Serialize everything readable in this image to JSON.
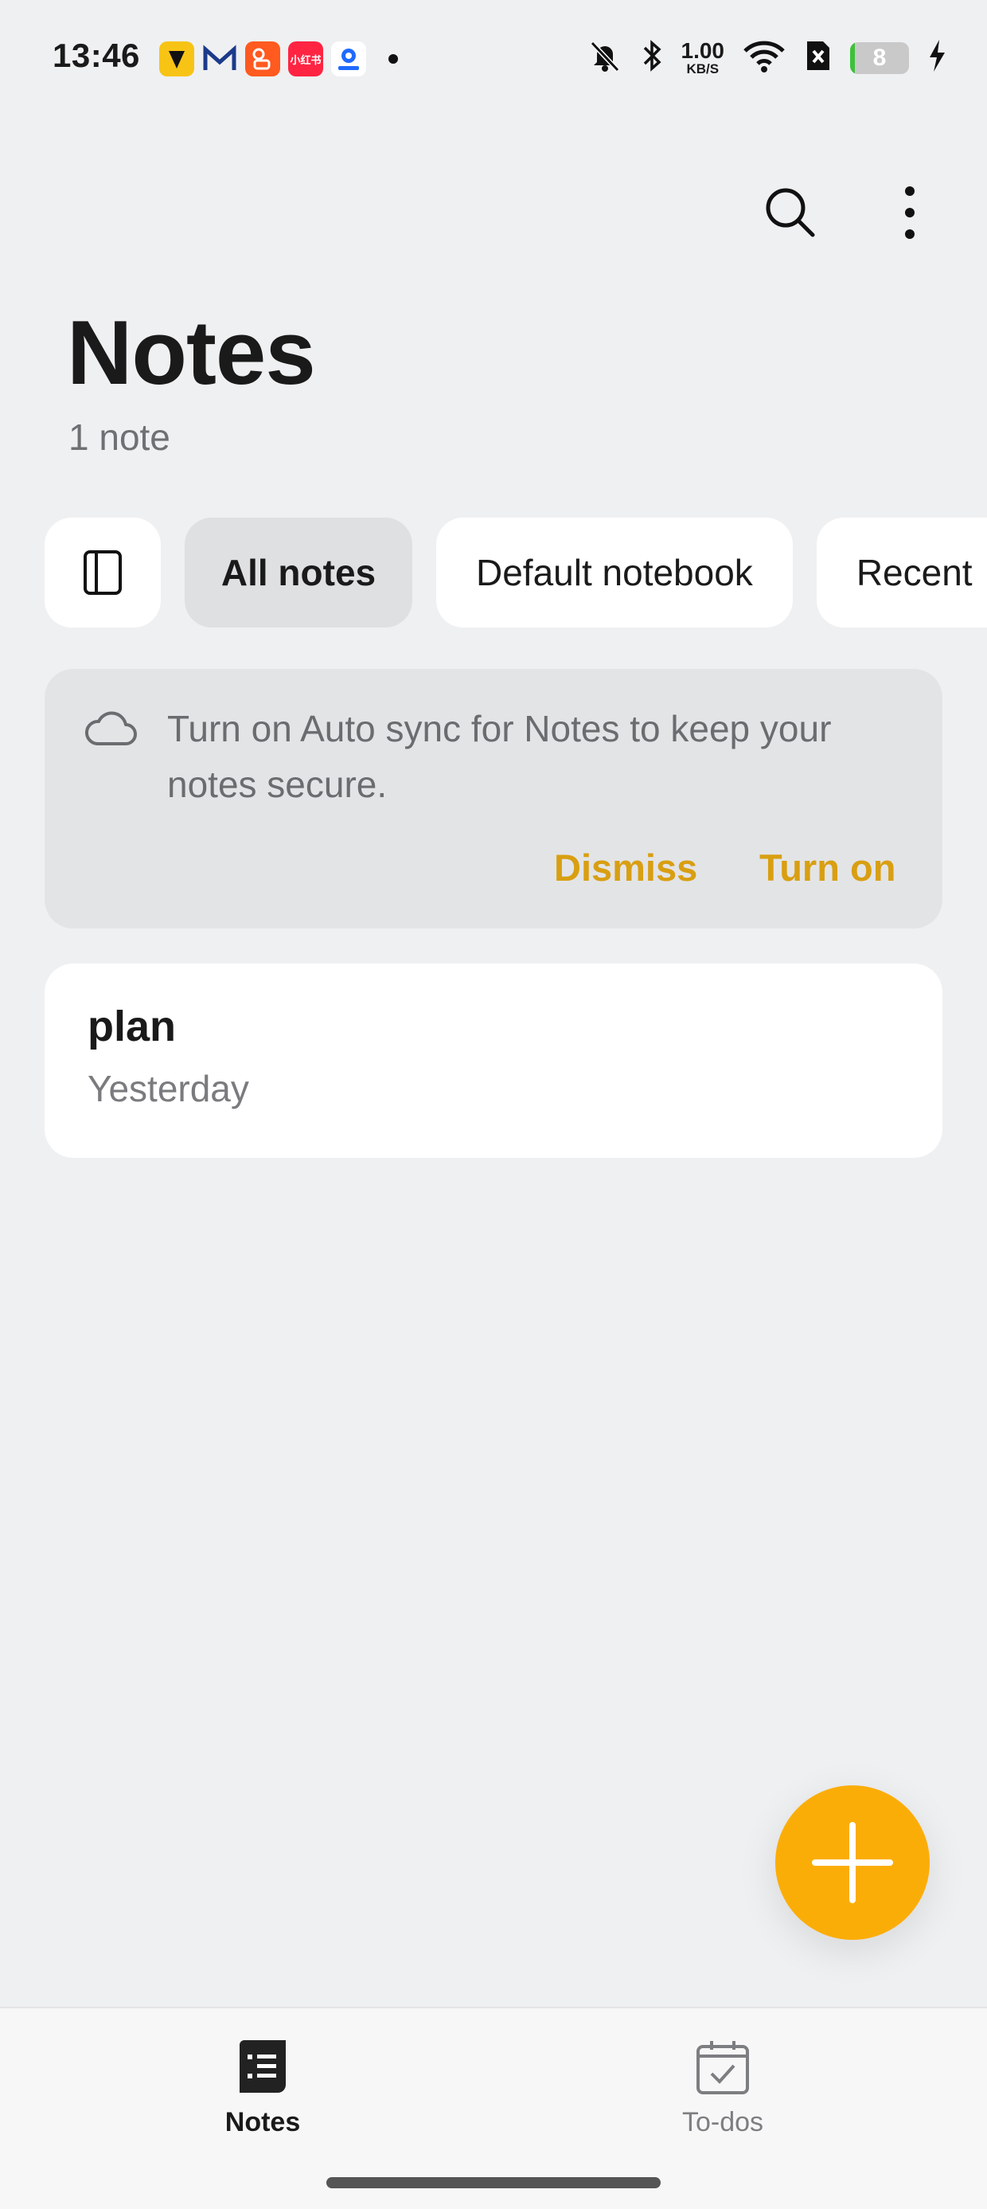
{
  "status_bar": {
    "time": "13:46",
    "net_speed_value": "1.00",
    "net_speed_unit": "KB/S",
    "battery_level": "8",
    "battery_percent": 8,
    "notification_icons": [
      "cat-app-icon",
      "mail-app-icon",
      "kuaishou-app-icon",
      "xiaohongshu-app-icon",
      "map-app-icon"
    ],
    "xiaohongshu_label": "小红书"
  },
  "header": {
    "title": "Notes",
    "count": "1 note"
  },
  "filters": {
    "items": [
      {
        "label": "All notes",
        "active": true
      },
      {
        "label": "Default notebook",
        "active": false
      },
      {
        "label": "Recent",
        "active": false
      }
    ]
  },
  "sync_banner": {
    "message": "Turn on Auto sync for Notes to keep your notes secure.",
    "dismiss_label": "Dismiss",
    "turn_on_label": "Turn on"
  },
  "notes": [
    {
      "title": "plan",
      "date": "Yesterday"
    }
  ],
  "bottom_nav": {
    "notes_label": "Notes",
    "todos_label": "To-dos"
  },
  "colors": {
    "accent": "#fbad07",
    "action_text": "#d99f12",
    "background": "#eff0f2"
  }
}
